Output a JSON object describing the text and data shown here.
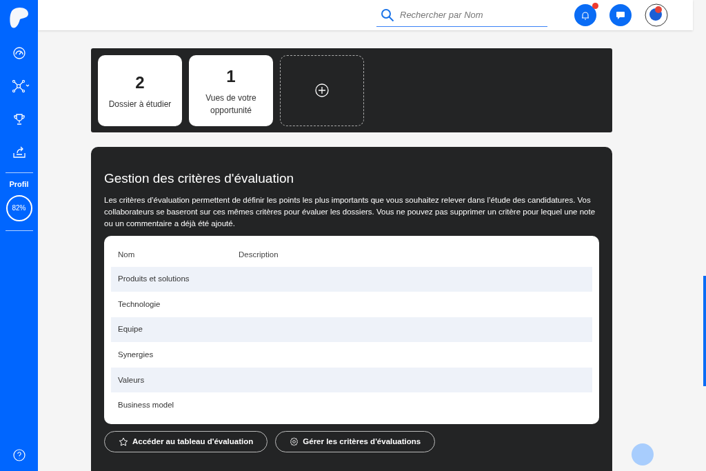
{
  "sidebar": {
    "profile": {
      "label": "Profil",
      "reading": "82%"
    }
  },
  "header": {
    "search": {
      "placeholder": "Rechercher par Nom"
    },
    "notifications": {
      "unread": true
    }
  },
  "stats": [
    {
      "value": "2",
      "label": "Dossier à étudier"
    },
    {
      "value": "1",
      "label": "Vues de votre opportunité"
    }
  ],
  "criteria": {
    "title": "Gestion des critères d'évaluation",
    "description": "Les critères d’évaluation permettent de définir les points les plus importants que vous souhaitez relever dans l’étude des candidatures. Vos collaborateurs se baseront sur ces mêmes critères pour évaluer les dossiers. Vous ne pouvez pas supprimer un critère pour lequel une note ou un commentaire a déjà été ajouté.",
    "table": {
      "columns": [
        "Nom",
        "Description"
      ],
      "rows": [
        {
          "name": "Produits et solutions"
        },
        {
          "name": "Technologie"
        },
        {
          "name": "Equipe"
        },
        {
          "name": "Synergies"
        },
        {
          "name": "Valeurs"
        },
        {
          "name": "Business model"
        }
      ]
    },
    "buttons": [
      {
        "label": "Accéder au tableau d'évaluation",
        "kind": "star"
      },
      {
        "label": "Gérer les critères d'évaluations",
        "kind": "gear"
      }
    ]
  }
}
